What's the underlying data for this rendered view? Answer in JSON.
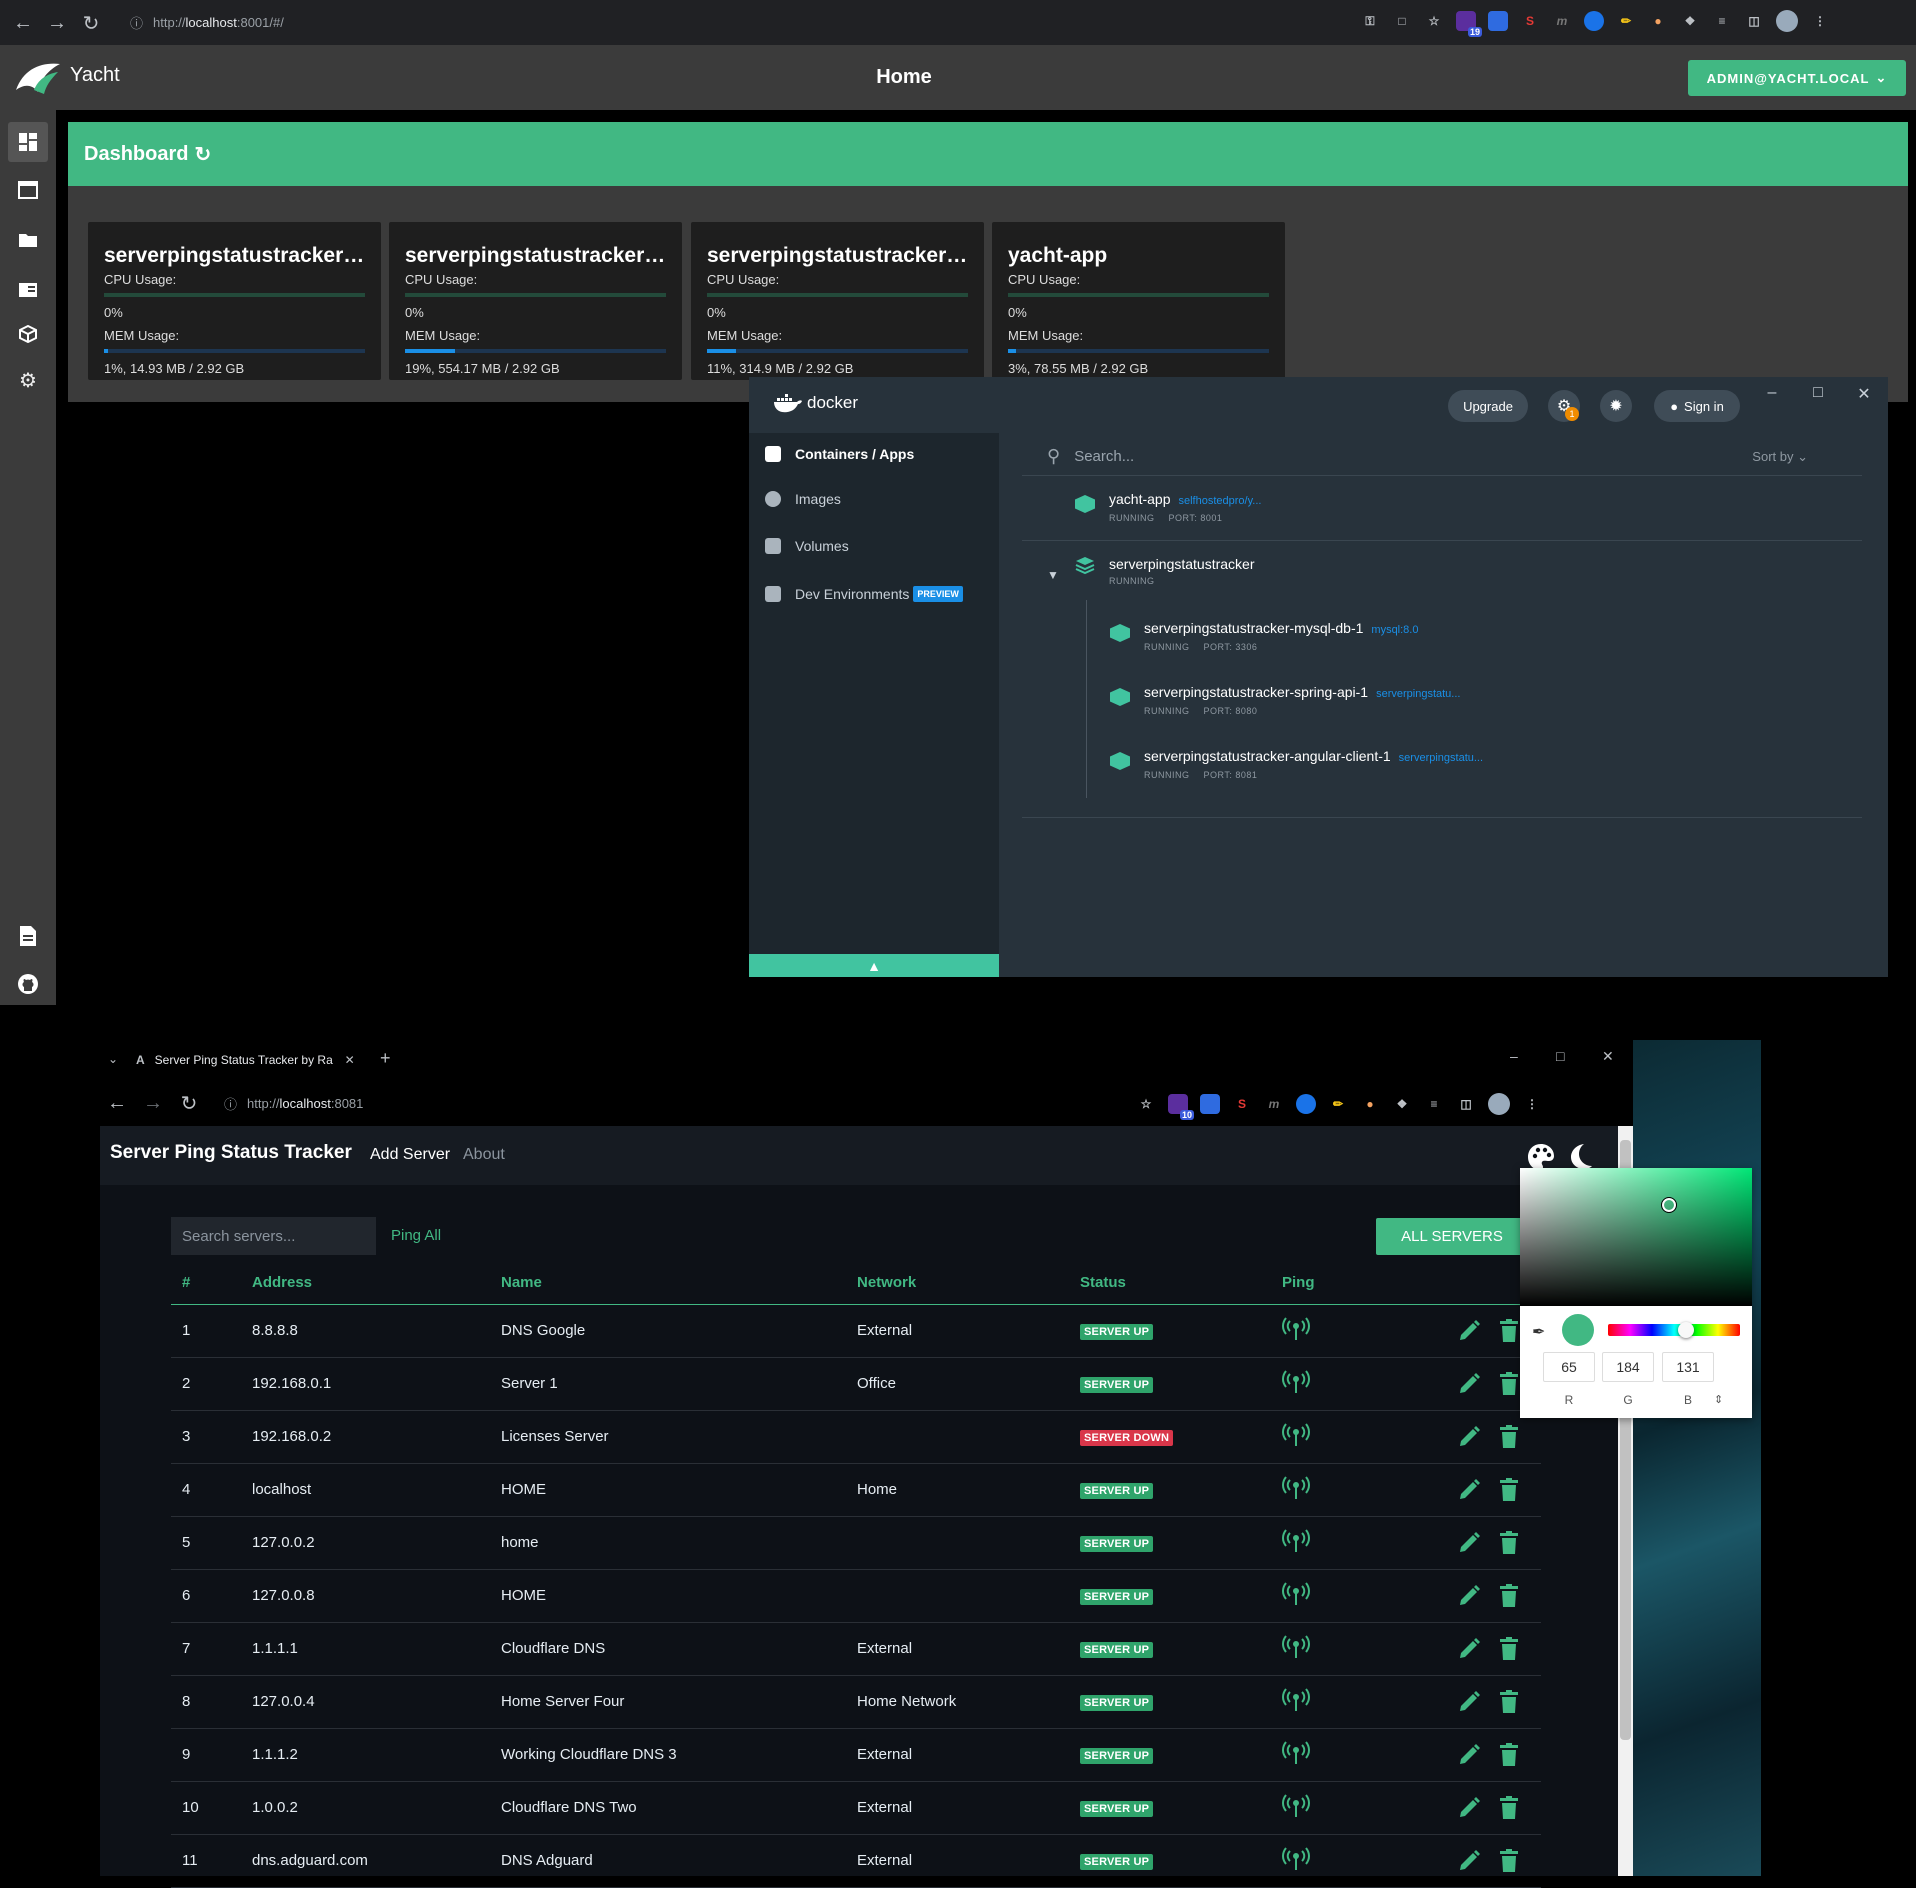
{
  "browser1": {
    "url_scheme": "http://",
    "url_host": "localhost",
    "url_rest": ":8001/#/",
    "extension_badge": "19"
  },
  "yacht": {
    "brand": "Yacht",
    "page_title": "Home",
    "user_button": "ADMIN@YACHT.LOCAL",
    "dashboard_title": "Dashboard",
    "cpu_label": "CPU Usage:",
    "mem_label": "MEM Usage:",
    "cards": [
      {
        "name": "serverpingstatustracker-a...",
        "cpu": "0%",
        "cpu_pct": 0,
        "mem": "1%, 14.93 MB / 2.92 GB",
        "mem_pct": 1
      },
      {
        "name": "serverpingstatustracker-m...",
        "cpu": "0%",
        "cpu_pct": 0,
        "mem": "19%, 554.17 MB / 2.92 GB",
        "mem_pct": 19
      },
      {
        "name": "serverpingstatustracker-s...",
        "cpu": "0%",
        "cpu_pct": 0,
        "mem": "11%, 314.9 MB / 2.92 GB",
        "mem_pct": 11
      },
      {
        "name": "yacht-app",
        "cpu": "0%",
        "cpu_pct": 0,
        "mem": "3%, 78.55 MB / 2.92 GB",
        "mem_pct": 3
      }
    ]
  },
  "docker": {
    "brand": "docker",
    "upgrade": "Upgrade",
    "notification_count": "1",
    "sign_in": "Sign in",
    "nav": {
      "containers": "Containers / Apps",
      "images": "Images",
      "volumes": "Volumes",
      "dev_env": "Dev Environments",
      "preview": "PREVIEW"
    },
    "search_placeholder": "Search...",
    "sort_by": "Sort by",
    "containers": {
      "yacht": {
        "name": "yacht-app",
        "image": "selfhostedpro/y...",
        "status": "RUNNING",
        "port": "PORT: 8001"
      },
      "group": {
        "name": "serverpingstatustracker",
        "status": "RUNNING"
      },
      "children": [
        {
          "name": "serverpingstatustracker-mysql-db-1",
          "image": "mysql:8.0",
          "status": "RUNNING",
          "port": "PORT: 3306"
        },
        {
          "name": "serverpingstatustracker-spring-api-1",
          "image": "serverpingstatu...",
          "status": "RUNNING",
          "port": "PORT: 8080"
        },
        {
          "name": "serverpingstatustracker-angular-client-1",
          "image": "serverpingstatu...",
          "status": "RUNNING",
          "port": "PORT: 8081"
        }
      ]
    }
  },
  "browser2": {
    "tab_title": "Server Ping Status Tracker by Ra",
    "url_scheme": "http://",
    "url_host": "localhost",
    "url_rest": ":8081",
    "extension_badge": "10"
  },
  "spst": {
    "title": "Server Ping Status Tracker",
    "nav_add": "Add Server",
    "nav_about": "About",
    "search_placeholder": "Search servers...",
    "ping_all": "Ping All",
    "all_servers": "ALL SERVERS",
    "columns": {
      "num": "#",
      "address": "Address",
      "name": "Name",
      "network": "Network",
      "status": "Status",
      "ping": "Ping"
    },
    "rows": [
      {
        "num": "1",
        "address": "8.8.8.8",
        "name": "DNS Google",
        "network": "External",
        "status": "SERVER UP"
      },
      {
        "num": "2",
        "address": "192.168.0.1",
        "name": "Server 1",
        "network": "Office",
        "status": "SERVER UP"
      },
      {
        "num": "3",
        "address": "192.168.0.2",
        "name": "Licenses Server",
        "network": "",
        "status": "SERVER DOWN"
      },
      {
        "num": "4",
        "address": "localhost",
        "name": "HOME",
        "network": "Home",
        "status": "SERVER UP"
      },
      {
        "num": "5",
        "address": "127.0.0.2",
        "name": "home",
        "network": "",
        "status": "SERVER UP"
      },
      {
        "num": "6",
        "address": "127.0.0.8",
        "name": "HOME",
        "network": "",
        "status": "SERVER UP"
      },
      {
        "num": "7",
        "address": "1.1.1.1",
        "name": "Cloudflare DNS",
        "network": "External",
        "status": "SERVER UP"
      },
      {
        "num": "8",
        "address": "127.0.0.4",
        "name": "Home Server Four",
        "network": "Home Network",
        "status": "SERVER UP"
      },
      {
        "num": "9",
        "address": "1.1.1.2",
        "name": "Working Cloudflare DNS 3",
        "network": "External",
        "status": "SERVER UP"
      },
      {
        "num": "10",
        "address": "1.0.0.2",
        "name": "Cloudflare DNS Two",
        "network": "External",
        "status": "SERVER UP"
      },
      {
        "num": "11",
        "address": "dns.adguard.com",
        "name": "DNS Adguard",
        "network": "External",
        "status": "SERVER UP"
      }
    ],
    "color_picker": {
      "r": "65",
      "g": "184",
      "b": "131",
      "r_label": "R",
      "g_label": "G",
      "b_label": "B",
      "swatch": "#41b883"
    }
  },
  "colors": {
    "accent": "#41b883",
    "danger": "#d9364a",
    "docker_teal": "#41c4a0",
    "docker_blue": "#1a8fe6"
  }
}
